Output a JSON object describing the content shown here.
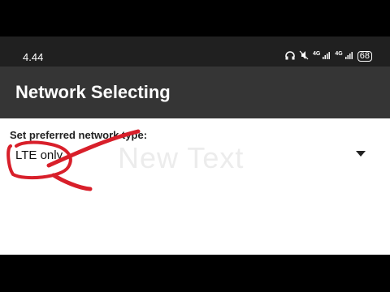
{
  "status_bar": {
    "time": "4.44",
    "icons": [
      "headphones-icon",
      "mute-icon",
      "signal-4g-1-icon",
      "signal-4g-2-icon"
    ],
    "signal_labels": [
      "4G",
      "4G"
    ],
    "battery": "68"
  },
  "app_bar": {
    "title": "Network Selecting"
  },
  "content": {
    "label": "Set preferred network type:",
    "selected_value": "LTE only"
  },
  "overlay": {
    "text": "New Text",
    "annotation_color": "#d81f2a"
  }
}
